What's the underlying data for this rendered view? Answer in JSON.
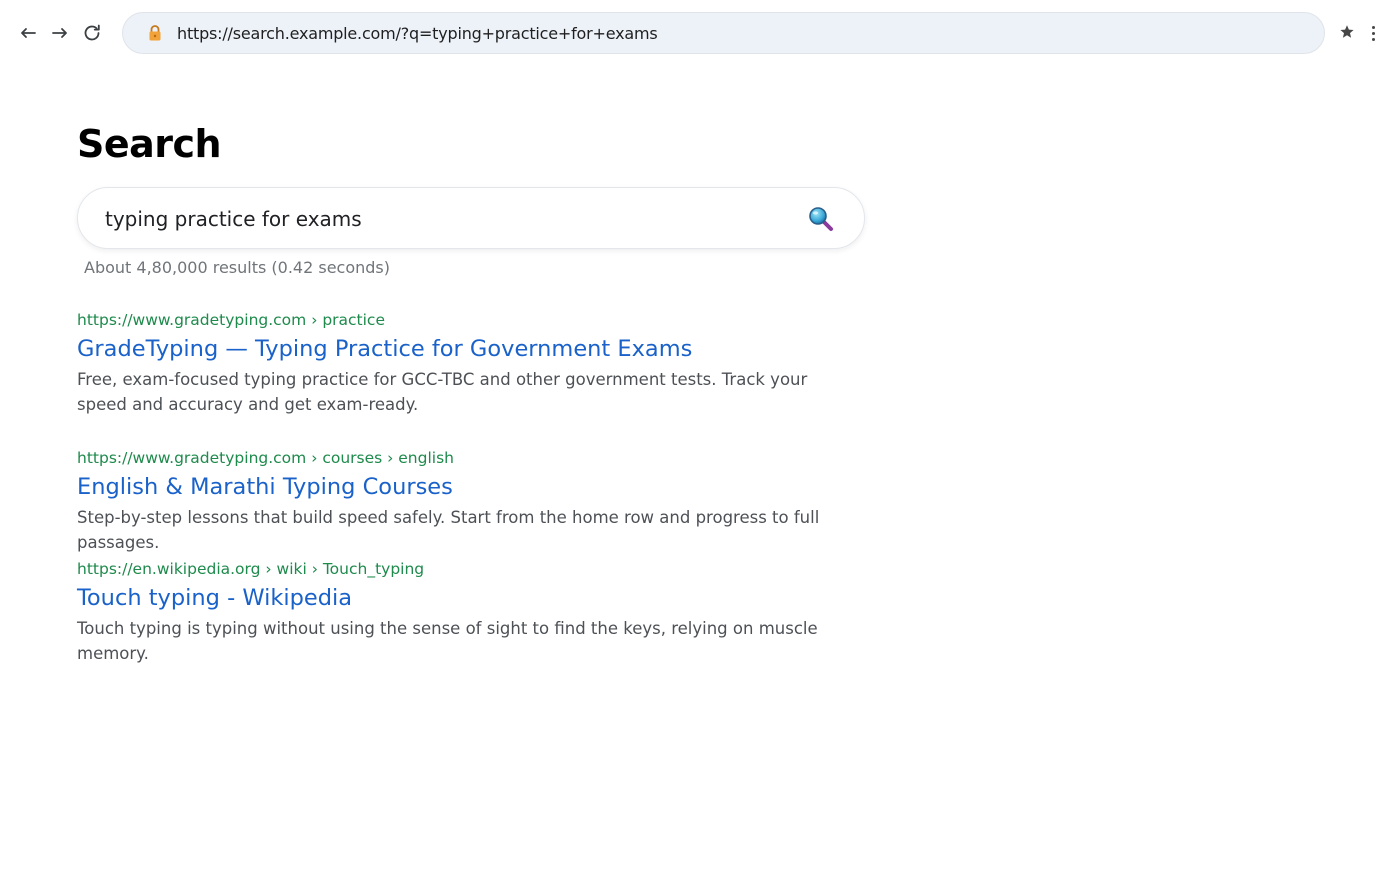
{
  "browser": {
    "url": "https://search.example.com/?q=typing+practice+for+exams",
    "icons": {
      "back": "arrow-left-icon",
      "forward": "arrow-right-icon",
      "reload": "reload-icon",
      "lock": "lock-icon",
      "bookmark": "star-icon",
      "menu": "kebab-menu-icon"
    }
  },
  "page": {
    "title": "Search",
    "search": {
      "value": "typing practice for exams",
      "button_icon": "magnifier-icon"
    },
    "stats": "About 4,80,000 results (0.42 seconds)",
    "results": [
      {
        "url": "https://www.gradetyping.com › practice",
        "title": "GradeTyping — Typing Practice for Government Exams",
        "snippet": "Free, exam-focused typing practice for GCC-TBC and other government tests. Track your speed and accuracy and get exam-ready."
      },
      {
        "url": "https://www.gradetyping.com › courses › english",
        "title": "English & Marathi Typing Courses",
        "snippet": "Step-by-step lessons that build speed safely. Start from the home row and progress to full passages."
      },
      {
        "url": "https://en.wikipedia.org › wiki › Touch_typing",
        "title": "Touch typing - Wikipedia",
        "snippet": "Touch typing is typing without using the sense of sight to find the keys, relying on muscle memory."
      }
    ]
  },
  "colors": {
    "link": "#1a62c9",
    "url_green": "#1e8a4c",
    "snippet": "#4d5156",
    "omnibox_bg": "#edf1f8"
  }
}
